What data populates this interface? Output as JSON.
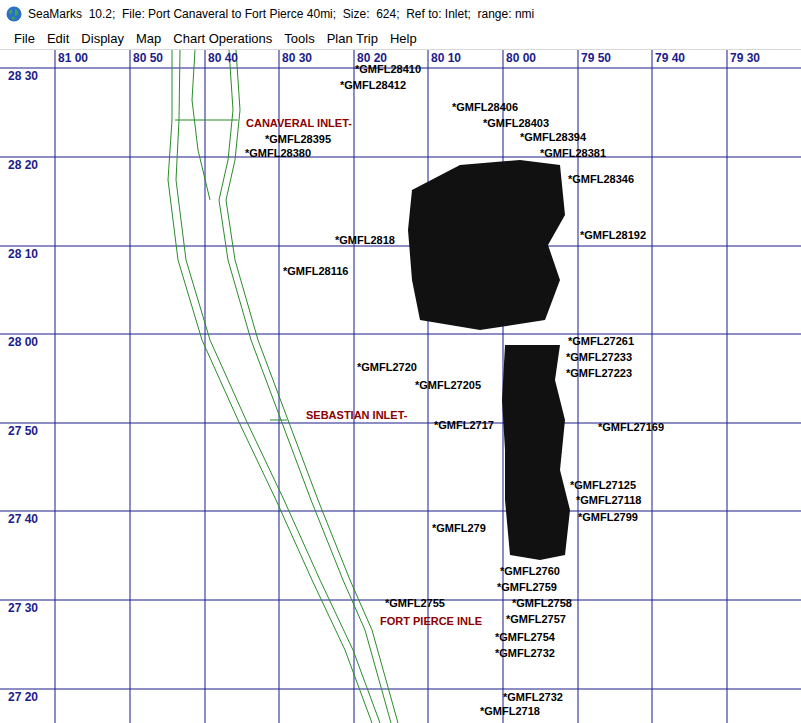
{
  "window": {
    "title": "SeaMarks  10.2;  File: Port Canaveral to Fort Pierce 40mi;  Size:  624;  Ref to: Inlet;  range: nmi"
  },
  "menu": [
    "File",
    "Edit",
    "Display",
    "Map",
    "Chart Operations",
    "Tools",
    "Plan Trip",
    "Help"
  ],
  "map": {
    "longitudes": [
      "81 00",
      "80 50",
      "80 40",
      "80 30",
      "80 20",
      "80 10",
      "80 00",
      "79 50",
      "79 40",
      "79 30"
    ],
    "latitudes": [
      "28 30",
      "28 20",
      "28 10",
      "28 00",
      "27 50",
      "27 40",
      "27 30",
      "27 20"
    ],
    "inlets": [
      {
        "label": "CANAVERAL INLET-"
      },
      {
        "label": "SEBASTIAN INLET-"
      },
      {
        "label": "FORT PIERCE INLE"
      }
    ],
    "marks": [
      {
        "label": "*GMFL28410"
      },
      {
        "label": "*GMFL28412"
      },
      {
        "label": "*GMFL28406"
      },
      {
        "label": "*GMFL28403"
      },
      {
        "label": "*GMFL28394"
      },
      {
        "label": "*GMFL28395"
      },
      {
        "label": "*GMFL28380"
      },
      {
        "label": "*GMFL28381"
      },
      {
        "label": "*GMFL28346"
      },
      {
        "label": "*GMFL28192"
      },
      {
        "label": "*GMFL2818"
      },
      {
        "label": "*GMFL28116"
      },
      {
        "label": "*GMFL27261"
      },
      {
        "label": "*GMFL27233"
      },
      {
        "label": "*GMFL27223"
      },
      {
        "label": "*GMFL2720"
      },
      {
        "label": "*GMFL27205"
      },
      {
        "label": "*GMFL2717"
      },
      {
        "label": "*GMFL27169"
      },
      {
        "label": "*GMFL27125"
      },
      {
        "label": "*GMFL27118"
      },
      {
        "label": "*GMFL2799"
      },
      {
        "label": "*GMFL279"
      },
      {
        "label": "*GMFL2760"
      },
      {
        "label": "*GMFL2759"
      },
      {
        "label": "*GMFL2758"
      },
      {
        "label": "*GMFL2757"
      },
      {
        "label": "*GMFL2755"
      },
      {
        "label": "*GMFL2754"
      },
      {
        "label": "*GMFL2732"
      },
      {
        "label": "*GMFL2732"
      },
      {
        "label": "*GMFL2718"
      }
    ]
  }
}
